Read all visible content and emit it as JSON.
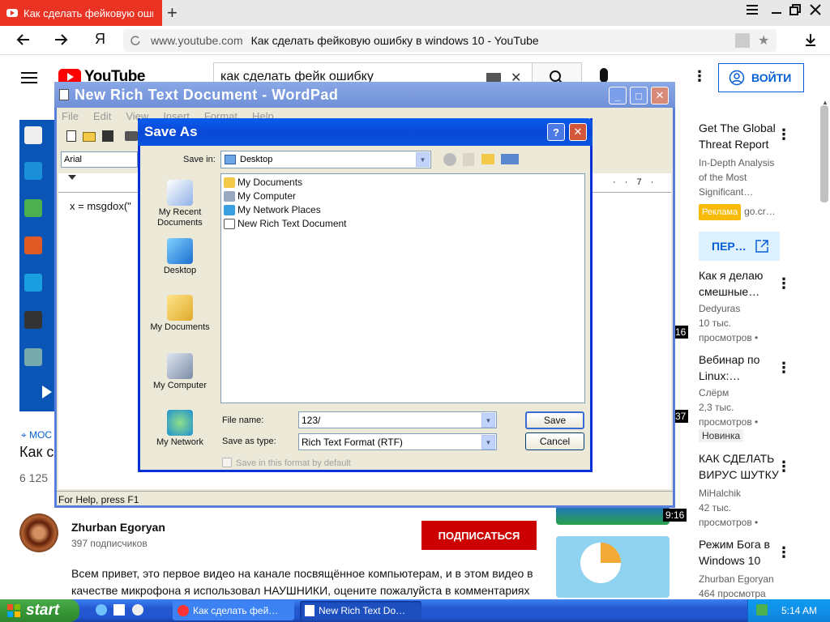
{
  "browser": {
    "tab_title": "Как сделать фейковую ошибку",
    "new_tab": "+",
    "url_domain": "www.youtube.com",
    "page_title": "Как сделать фейковую ошибку в windows 10 - YouTube",
    "yandex": "Я"
  },
  "youtube": {
    "logo": "YouTube",
    "search_value": "как сделать фейк ошибку",
    "login": "ВОЙТИ",
    "location_fragment": "МОС",
    "title_fragment": "Как с",
    "views_fragment": "6 125",
    "channel": "Zhurban Egoryan",
    "subscribers": "397 подписчиков",
    "subscribe": "ПОДПИСАТЬСЯ",
    "description_line1": "Всем привет, это первое видео на канале посвящённое компьютерам, и в этом видео в",
    "description_line2": "качестве микрофона я использовал НАУШНИКИ, оцените пожалуйста в комментариях"
  },
  "sidebar": {
    "ad": {
      "title1": "Get The Global",
      "title2": "Threat Report",
      "line1": "In-Depth Analysis",
      "line2": "of the Most",
      "line3": "Significant…",
      "badge": "Реклама",
      "domain": "go.cr…",
      "button": "ПЕР…"
    },
    "videos": [
      {
        "title1": "Как я делаю",
        "title2": "смешные…",
        "channel": "Dedyuras",
        "views": "10 тыс.",
        "meta": "просмотров •",
        "duration": "16"
      },
      {
        "title1": "Вебинар по",
        "title2": "Linux:…",
        "channel": "Слёрм",
        "views": "2,3 тыс.",
        "meta": "просмотров •",
        "badge": "Новинка",
        "duration": "37"
      },
      {
        "title1": "КАК СДЕЛАТЬ",
        "title2": "ВИРУС ШУТКУ",
        "channel": "MiHalchik",
        "views": "42 тыс.",
        "meta": "просмотров •",
        "duration": "9:16"
      },
      {
        "title1": "Режим Бога в",
        "title2": "Windows 10",
        "channel": "Zhurban Egoryan",
        "views": "464 просмотра",
        "meta": ""
      }
    ]
  },
  "wordpad": {
    "title": "New Rich Text Document - WordPad",
    "menu": [
      "File",
      "Edit",
      "View",
      "Insert",
      "Format",
      "Help"
    ],
    "font": "Arial",
    "ruler_mark": "7",
    "content": "x = msgdox(\"",
    "status": "For Help, press F1"
  },
  "save_dialog": {
    "title": "Save As",
    "help": "?",
    "save_in_label": "Save in:",
    "save_in_value": "Desktop",
    "places": [
      "My Recent Documents",
      "Desktop",
      "My Documents",
      "My Computer",
      "My Network"
    ],
    "files": [
      "My Documents",
      "My Computer",
      "My Network Places",
      "New Rich Text Document"
    ],
    "file_name_label": "File name:",
    "file_name_value": "123/",
    "save_as_type_label": "Save as type:",
    "save_as_type_value": "Rich Text Format (RTF)",
    "save_button": "Save",
    "cancel_button": "Cancel",
    "default_checkbox": "Save in this format by default"
  },
  "taskbar": {
    "start": "start",
    "task1": "Как сделать фей…",
    "task2": "New Rich Text Do…",
    "clock": "5:14 AM"
  }
}
